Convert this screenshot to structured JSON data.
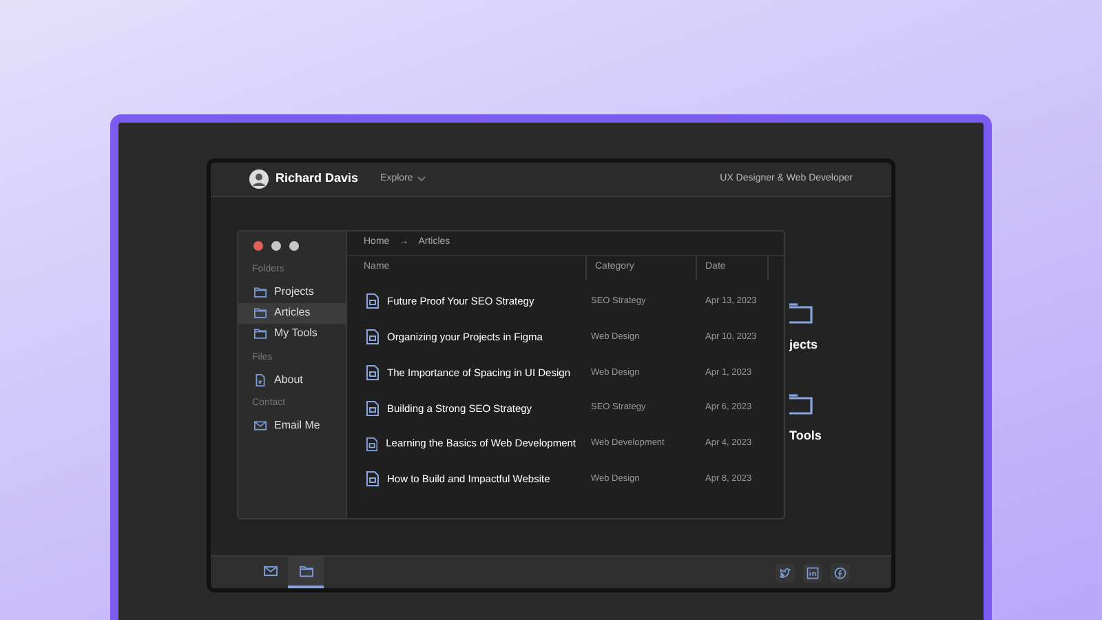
{
  "header": {
    "name": "Richard Davis",
    "nav": "Explore",
    "tagline": "UX Designer & Web Developer"
  },
  "window": {
    "breadcrumb": [
      "Home",
      "→",
      "Articles"
    ],
    "sidebar": [
      {
        "title": "Folders",
        "items": [
          {
            "label": "Projects",
            "kind": "folder",
            "selected": false
          },
          {
            "label": "Articles",
            "kind": "folder",
            "selected": true
          },
          {
            "label": "My Tools",
            "kind": "folder",
            "selected": false
          }
        ]
      },
      {
        "title": "Files",
        "items": [
          {
            "label": "About",
            "kind": "file",
            "selected": false
          }
        ]
      },
      {
        "title": "Contact",
        "items": [
          {
            "label": "Email Me",
            "kind": "mail",
            "selected": false
          }
        ]
      }
    ],
    "columns": [
      "Name",
      "Category",
      "Date"
    ],
    "rows": [
      {
        "name": "Future Proof Your SEO Strategy",
        "category": "SEO Strategy",
        "date": "Apr 13, 2023"
      },
      {
        "name": "Organizing your Projects in Figma",
        "category": "Web Design",
        "date": "Apr 10, 2023"
      },
      {
        "name": "The Importance of Spacing in UI Design",
        "category": "Web Design",
        "date": "Apr 1, 2023"
      },
      {
        "name": "Building a Strong SEO Strategy",
        "category": "SEO Strategy",
        "date": "Apr 6, 2023"
      },
      {
        "name": "Learning the Basics of Web Development",
        "category": "Web Development",
        "date": "Apr 4, 2023"
      },
      {
        "name": "How to Build and Impactful Website",
        "category": "Web Design",
        "date": "Apr 8, 2023"
      }
    ]
  },
  "desktop_icons": [
    {
      "label": "jects"
    },
    {
      "label": "Tools"
    }
  ],
  "dock": {
    "left": [
      {
        "kind": "mail",
        "selected": false
      },
      {
        "kind": "folder",
        "selected": true
      }
    ],
    "right": [
      {
        "kind": "twitter"
      },
      {
        "kind": "linkedin"
      },
      {
        "kind": "facebook"
      }
    ]
  }
}
